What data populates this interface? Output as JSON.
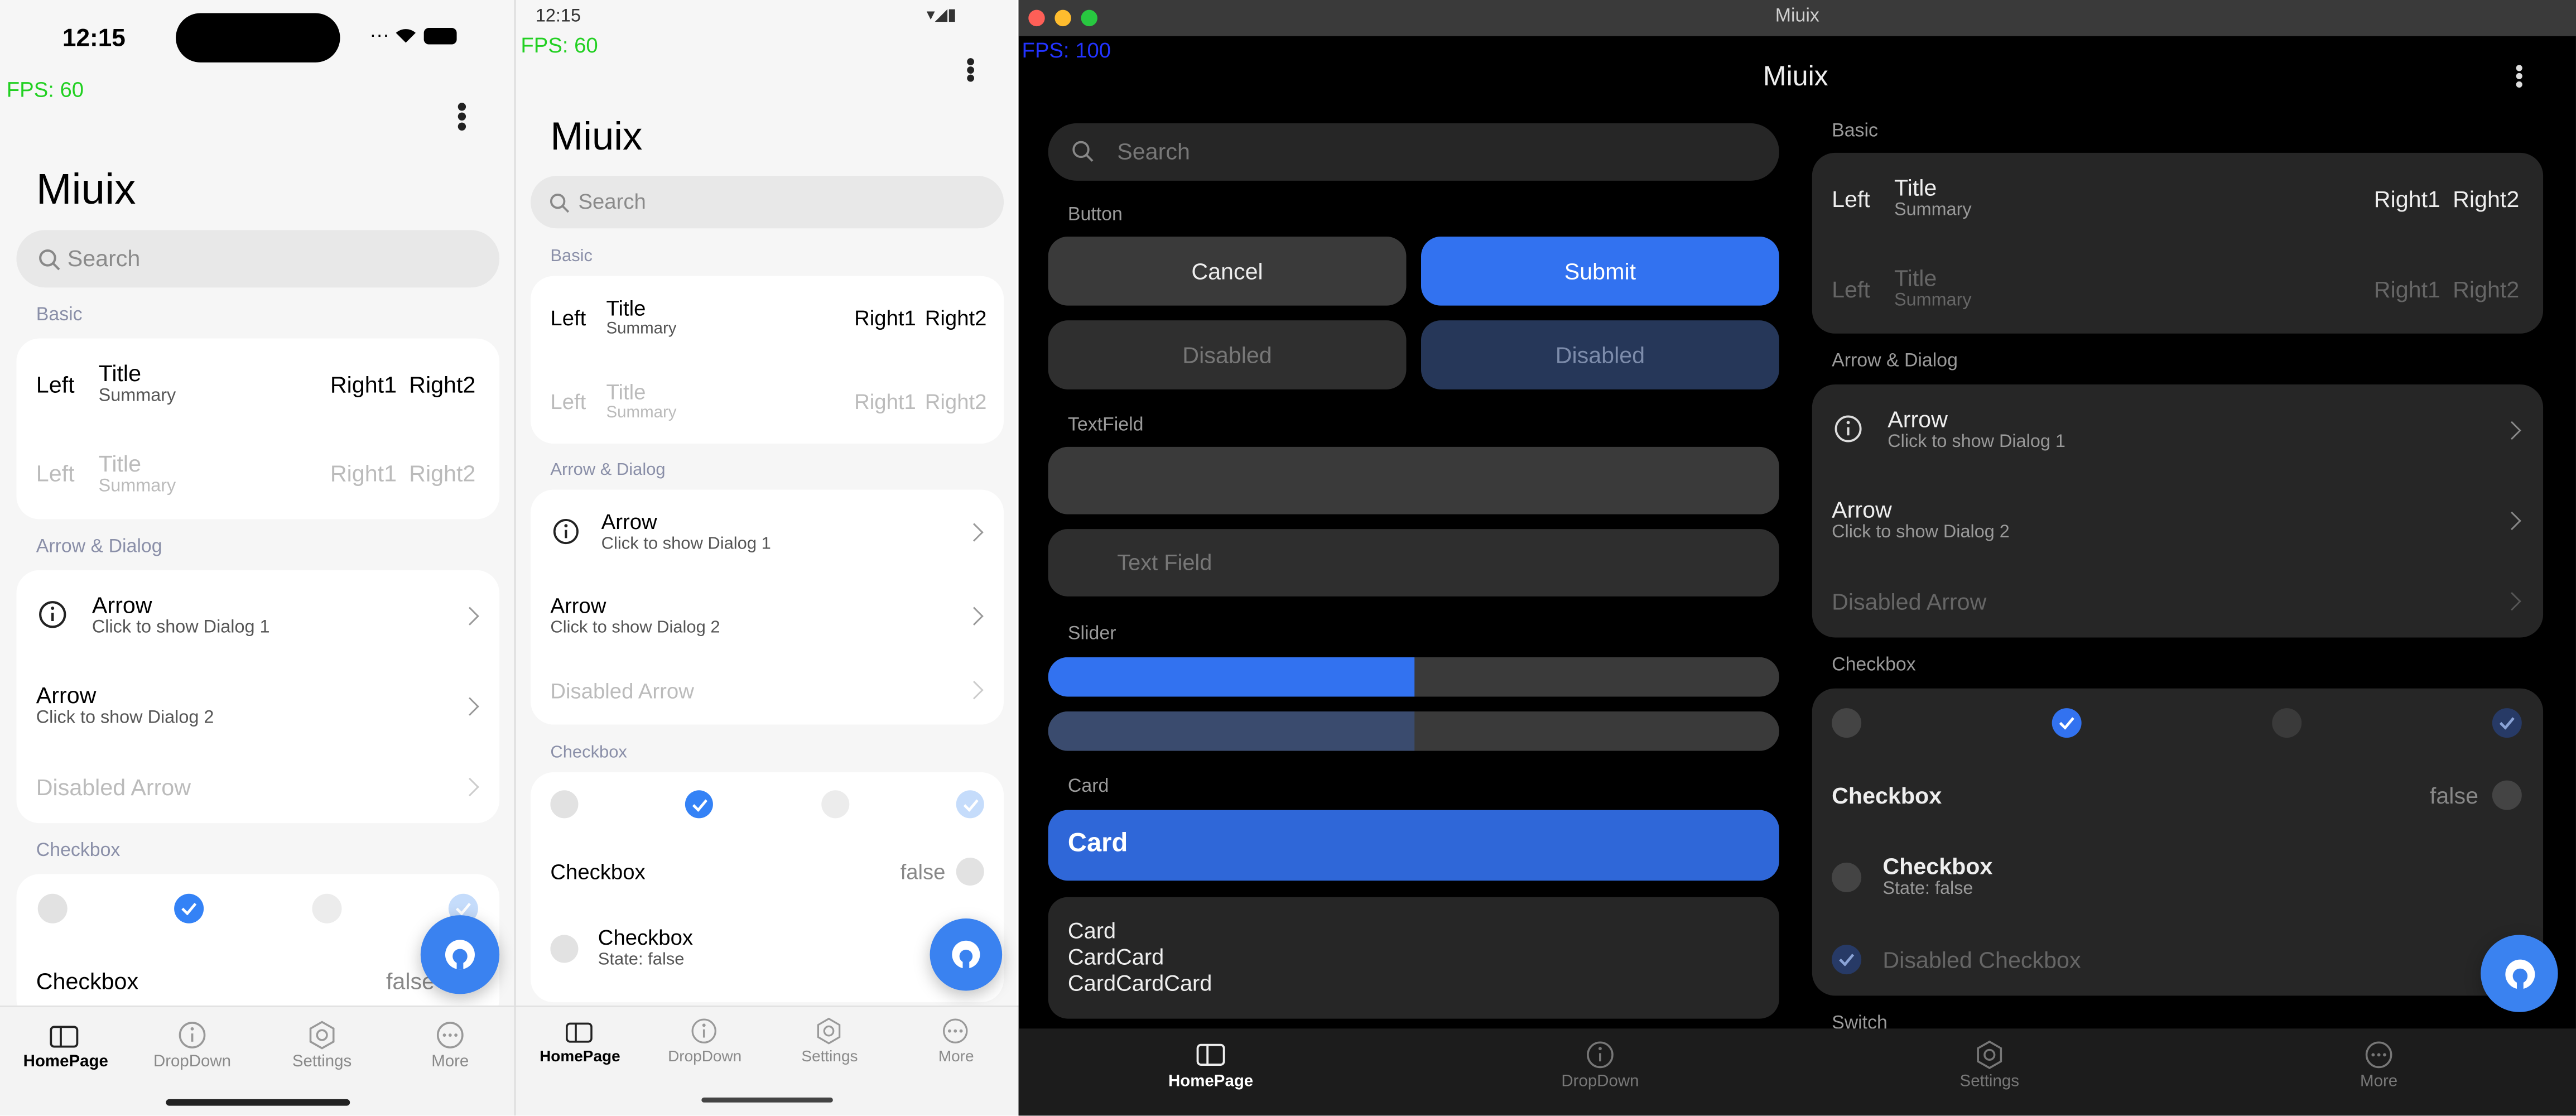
{
  "colors": {
    "accent": "#3482f6",
    "dark_accent": "#2f67d8",
    "fps_green": "#22d022",
    "fps_blue": "#2233ff"
  },
  "phone1": {
    "time": "12:15",
    "fps": "FPS: 60",
    "title": "Miuix",
    "search_placeholder": "Search",
    "basic_section": "Basic",
    "row1": {
      "left": "Left",
      "title": "Title",
      "summary": "Summary",
      "right1": "Right1",
      "right2": "Right2"
    },
    "row2": {
      "left": "Left",
      "title": "Title",
      "summary": "Summary",
      "right1": "Right1",
      "right2": "Right2"
    },
    "arrow_section": "Arrow & Dialog",
    "arrow1": {
      "title": "Arrow",
      "summary": "Click to show Dialog 1"
    },
    "arrow2": {
      "title": "Arrow",
      "summary": "Click to show Dialog 2"
    },
    "disabled_arrow": "Disabled Arrow",
    "checkbox_section": "Checkbox",
    "checkbox_row": {
      "label": "Checkbox",
      "value": "false"
    },
    "nav": [
      "HomePage",
      "DropDown",
      "Settings",
      "More"
    ]
  },
  "phone2": {
    "time": "12:15",
    "fps": "FPS: 60",
    "title": "Miuix",
    "search_placeholder": "Search",
    "basic_section": "Basic",
    "row1": {
      "left": "Left",
      "title": "Title",
      "summary": "Summary",
      "right1": "Right1",
      "right2": "Right2"
    },
    "row2": {
      "left": "Left",
      "title": "Title",
      "summary": "Summary",
      "right1": "Right1",
      "right2": "Right2"
    },
    "arrow_section": "Arrow & Dialog",
    "arrow1": {
      "title": "Arrow",
      "summary": "Click to show Dialog 1"
    },
    "arrow2": {
      "title": "Arrow",
      "summary": "Click to show Dialog 2"
    },
    "disabled_arrow": "Disabled Arrow",
    "checkbox_section": "Checkbox",
    "checkbox_row": {
      "label": "Checkbox",
      "value": "false"
    },
    "checkbox_state": {
      "title": "Checkbox",
      "summary": "State: false"
    },
    "nav": [
      "HomePage",
      "DropDown",
      "Settings",
      "More"
    ]
  },
  "desktop": {
    "window_title": "Miuix",
    "fps": "FPS: 100",
    "title": "Miuix",
    "search_placeholder": "Search",
    "button_section": "Button",
    "cancel": "Cancel",
    "submit": "Submit",
    "disabled1": "Disabled",
    "disabled2": "Disabled",
    "textfield_section": "TextField",
    "textfield_placeholder": "Text Field",
    "slider_section": "Slider",
    "slider1_value": 0.5,
    "slider2_value": 0.5,
    "card_section": "Card",
    "card_title": "Card",
    "card_lines": [
      "Card",
      "CardCard",
      "CardCardCard"
    ],
    "basic_section": "Basic",
    "row1": {
      "left": "Left",
      "title": "Title",
      "summary": "Summary",
      "right1": "Right1",
      "right2": "Right2"
    },
    "row2": {
      "left": "Left",
      "title": "Title",
      "summary": "Summary",
      "right1": "Right1",
      "right2": "Right2"
    },
    "arrow_section": "Arrow & Dialog",
    "arrow1": {
      "title": "Arrow",
      "summary": "Click to show Dialog 1"
    },
    "arrow2": {
      "title": "Arrow",
      "summary": "Click to show Dialog 2"
    },
    "disabled_arrow": "Disabled Arrow",
    "checkbox_section": "Checkbox",
    "checkbox_row": {
      "label": "Checkbox",
      "value": "false"
    },
    "checkbox_state": {
      "title": "Checkbox",
      "summary": "State: false"
    },
    "disabled_checkbox": "Disabled Checkbox",
    "switch_section": "Switch",
    "nav": [
      "HomePage",
      "DropDown",
      "Settings",
      "More"
    ]
  }
}
